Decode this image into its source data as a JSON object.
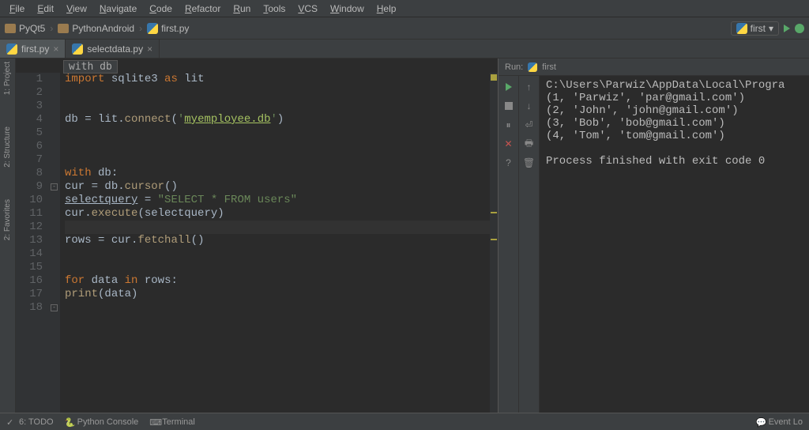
{
  "menu": [
    "File",
    "Edit",
    "View",
    "Navigate",
    "Code",
    "Refactor",
    "Run",
    "Tools",
    "VCS",
    "Window",
    "Help"
  ],
  "breadcrumb": {
    "folders": [
      "PyQt5",
      "PythonAndroid"
    ],
    "file": "first.py"
  },
  "run_config": "first",
  "tabs": [
    {
      "name": "first.py",
      "active": true
    },
    {
      "name": "selectdata.py",
      "active": false
    }
  ],
  "context": "with db",
  "left_tools": [
    "1: Project",
    "2: Structure",
    "2: Favorites"
  ],
  "code": {
    "lines": [
      {
        "n": 1,
        "tokens": [
          [
            "kw",
            "import"
          ],
          [
            "",
            " "
          ],
          [
            "ident",
            "sqlite3"
          ],
          [
            "",
            " "
          ],
          [
            "kw",
            "as"
          ],
          [
            "",
            " "
          ],
          [
            "ident",
            "lit"
          ]
        ]
      },
      {
        "n": 2,
        "tokens": []
      },
      {
        "n": 3,
        "tokens": []
      },
      {
        "n": 4,
        "tokens": [
          [
            "ident",
            "db "
          ],
          [
            "",
            "= "
          ],
          [
            "ident",
            "lit"
          ],
          [
            "",
            "."
          ],
          [
            "fn",
            "connect"
          ],
          [
            "",
            "("
          ],
          [
            "str",
            "'"
          ],
          [
            "strlit",
            "myemployee.db"
          ],
          [
            "str",
            "'"
          ],
          [
            "",
            ")"
          ]
        ]
      },
      {
        "n": 5,
        "tokens": []
      },
      {
        "n": 6,
        "tokens": []
      },
      {
        "n": 7,
        "tokens": []
      },
      {
        "n": 8,
        "tokens": [
          [
            "kw",
            "with"
          ],
          [
            "",
            " "
          ],
          [
            "ident",
            "db"
          ],
          [
            "",
            ":"
          ]
        ]
      },
      {
        "n": 9,
        "tokens": [
          [
            "",
            "    "
          ],
          [
            "ident",
            "cur "
          ],
          [
            "",
            "= "
          ],
          [
            "ident",
            "db"
          ],
          [
            "",
            "."
          ],
          [
            "fn",
            "cursor"
          ],
          [
            "",
            "()"
          ]
        ]
      },
      {
        "n": 10,
        "tokens": [
          [
            "",
            "    "
          ],
          [
            "ident underline",
            "selectquery"
          ],
          [
            "",
            " = "
          ],
          [
            "str",
            "\"SELECT * FROM users\""
          ]
        ]
      },
      {
        "n": 11,
        "tokens": [
          [
            "",
            "    "
          ],
          [
            "ident",
            "cur"
          ],
          [
            "",
            "."
          ],
          [
            "fn",
            "execute"
          ],
          [
            "",
            "("
          ],
          [
            "ident",
            "selectquery"
          ],
          [
            "",
            ")"
          ]
        ]
      },
      {
        "n": 12,
        "tokens": []
      },
      {
        "n": 13,
        "tokens": [
          [
            "",
            "    "
          ],
          [
            "ident",
            "rows "
          ],
          [
            "",
            "= "
          ],
          [
            "ident",
            "cur"
          ],
          [
            "",
            "."
          ],
          [
            "fn",
            "fetchall"
          ],
          [
            "",
            "()"
          ]
        ]
      },
      {
        "n": 14,
        "tokens": []
      },
      {
        "n": 15,
        "tokens": []
      },
      {
        "n": 16,
        "tokens": [
          [
            "",
            "    "
          ],
          [
            "kw",
            "for"
          ],
          [
            "",
            " "
          ],
          [
            "ident",
            "data"
          ],
          [
            "",
            " "
          ],
          [
            "kw",
            "in"
          ],
          [
            "",
            " "
          ],
          [
            "ident",
            "rows"
          ],
          [
            "",
            ":"
          ]
        ]
      },
      {
        "n": 17,
        "tokens": [
          [
            "",
            "        "
          ],
          [
            "fn",
            "print"
          ],
          [
            "",
            "("
          ],
          [
            "ident",
            "data"
          ],
          [
            "",
            ")"
          ]
        ]
      },
      {
        "n": 18,
        "tokens": []
      }
    ],
    "highlight_line": 12
  },
  "run": {
    "title_prefix": "Run:",
    "title": "first",
    "output": [
      "C:\\Users\\Parwiz\\AppData\\Local\\Progra",
      "(1, 'Parwiz', 'par@gmail.com')",
      "(2, 'John', 'john@gmail.com')",
      "(3, 'Bob', 'bob@gmail.com')",
      "(4, 'Tom', 'tom@gmail.com')",
      "",
      "Process finished with exit code 0"
    ]
  },
  "bottom": {
    "left": [
      "6: TODO",
      "Python Console",
      "Terminal"
    ],
    "right": "Event Lo"
  }
}
